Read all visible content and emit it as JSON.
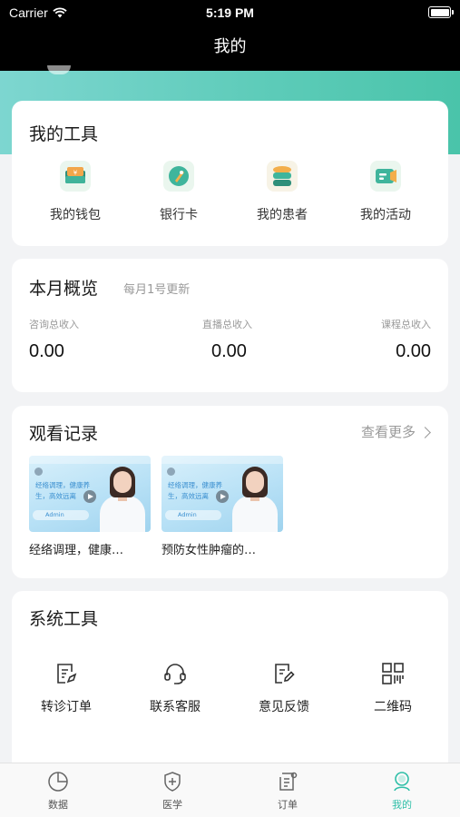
{
  "status_bar": {
    "carrier": "Carrier",
    "time": "5:19 PM"
  },
  "nav": {
    "title": "我的"
  },
  "my_tools": {
    "title": "我的工具",
    "items": [
      {
        "label": "我的钱包",
        "icon": "wallet-icon"
      },
      {
        "label": "银行卡",
        "icon": "bank-card-icon"
      },
      {
        "label": "我的患者",
        "icon": "patients-icon"
      },
      {
        "label": "我的活动",
        "icon": "activity-icon"
      }
    ]
  },
  "overview": {
    "title": "本月概览",
    "subtitle": "每月1号更新",
    "items": [
      {
        "label": "咨询总收入",
        "value": "0.00"
      },
      {
        "label": "直播总收入",
        "value": "0.00"
      },
      {
        "label": "课程总收入",
        "value": "0.00"
      }
    ]
  },
  "history": {
    "title": "观看记录",
    "more": "查看更多",
    "videos": [
      {
        "title": "经络调理，健康…",
        "thumb_text": "经络调理，健康养生，高效远离",
        "thumb_badge": "Admin"
      },
      {
        "title": "预防女性肿瘤的…",
        "thumb_text": "经络调理，健康养生，高效远离",
        "thumb_badge": "Admin"
      }
    ]
  },
  "system_tools": {
    "title": "系统工具",
    "items": [
      {
        "label": "转诊订单",
        "icon": "referral-order-icon"
      },
      {
        "label": "联系客服",
        "icon": "headset-icon"
      },
      {
        "label": "意见反馈",
        "icon": "feedback-icon"
      },
      {
        "label": "二维码",
        "icon": "qrcode-icon"
      }
    ]
  },
  "tab_bar": {
    "items": [
      {
        "label": "数据",
        "icon": "pie-chart-icon"
      },
      {
        "label": "医学",
        "icon": "shield-plus-icon"
      },
      {
        "label": "订单",
        "icon": "order-doc-icon"
      },
      {
        "label": "我的",
        "icon": "profile-icon",
        "active": true
      }
    ],
    "active_color": "#2fbfa8"
  },
  "colors": {
    "accent": "#4ac4aa"
  }
}
